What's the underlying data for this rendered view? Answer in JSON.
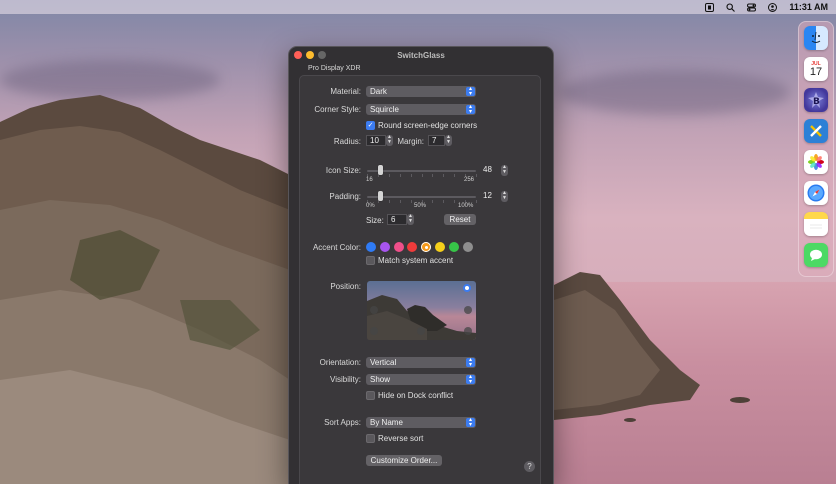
{
  "menubar": {
    "clock": "11:31 AM",
    "icons": [
      "display-icon",
      "search-icon",
      "control-center-icon",
      "user-icon"
    ]
  },
  "dock": {
    "apps": [
      {
        "name": "finder",
        "icon": "finder-icon",
        "color": "#3b8df3"
      },
      {
        "name": "calendar",
        "month": "JUL",
        "day": "17",
        "icon": "calendar-icon",
        "color": "#ffffff"
      },
      {
        "name": "switchglass",
        "icon": "switchglass-icon",
        "color": "#5a4fa5"
      },
      {
        "name": "xcode-tools",
        "icon": "tools-icon",
        "color": "#2d80d6"
      },
      {
        "name": "photos",
        "icon": "photos-icon",
        "color": "#ffffff"
      },
      {
        "name": "safari",
        "icon": "safari-icon",
        "color": "#2a7bf0"
      },
      {
        "name": "notes",
        "icon": "notes-icon",
        "color": "#ffd84a"
      },
      {
        "name": "messages",
        "icon": "messages-icon",
        "color": "#4cd964"
      }
    ]
  },
  "window": {
    "title": "SwitchGlass",
    "display": "Pro Display XDR"
  },
  "settings": {
    "material_label": "Material:",
    "material_value": "Dark",
    "corner_style_label": "Corner Style:",
    "corner_style_value": "Squircle",
    "round_corners_label": "Round screen-edge corners",
    "round_corners_checked": true,
    "radius_label": "Radius:",
    "radius_value": "10",
    "margin_label": "Margin:",
    "margin_value": "7",
    "icon_size_label": "Icon Size:",
    "icon_size_value": "48",
    "icon_size_min": "16",
    "icon_size_max": "256",
    "icon_size_fraction": 0.125,
    "padding_label": "Padding:",
    "padding_value": "12",
    "padding_ticks": [
      "0%",
      "50%",
      "100%"
    ],
    "padding_fraction": 0.125,
    "size_label": "Size:",
    "size_value": "6",
    "reset_label": "Reset",
    "accent_label": "Accent Color:",
    "accent_colors": [
      "#2f7bf5",
      "#a855f0",
      "#ef4f8a",
      "#ef3b3b",
      "#f59a1a",
      "#f5cf1a",
      "#37c548",
      "#8e8e8e"
    ],
    "accent_selected_index": 4,
    "match_accent_label": "Match system accent",
    "position_label": "Position:",
    "orientation_label": "Orientation:",
    "orientation_value": "Vertical",
    "visibility_label": "Visibility:",
    "visibility_value": "Show",
    "hide_dock_label": "Hide on Dock conflict",
    "sort_label": "Sort Apps:",
    "sort_value": "By Name",
    "reverse_label": "Reverse sort",
    "customize_label": "Customize Order...",
    "help_label": "?"
  }
}
